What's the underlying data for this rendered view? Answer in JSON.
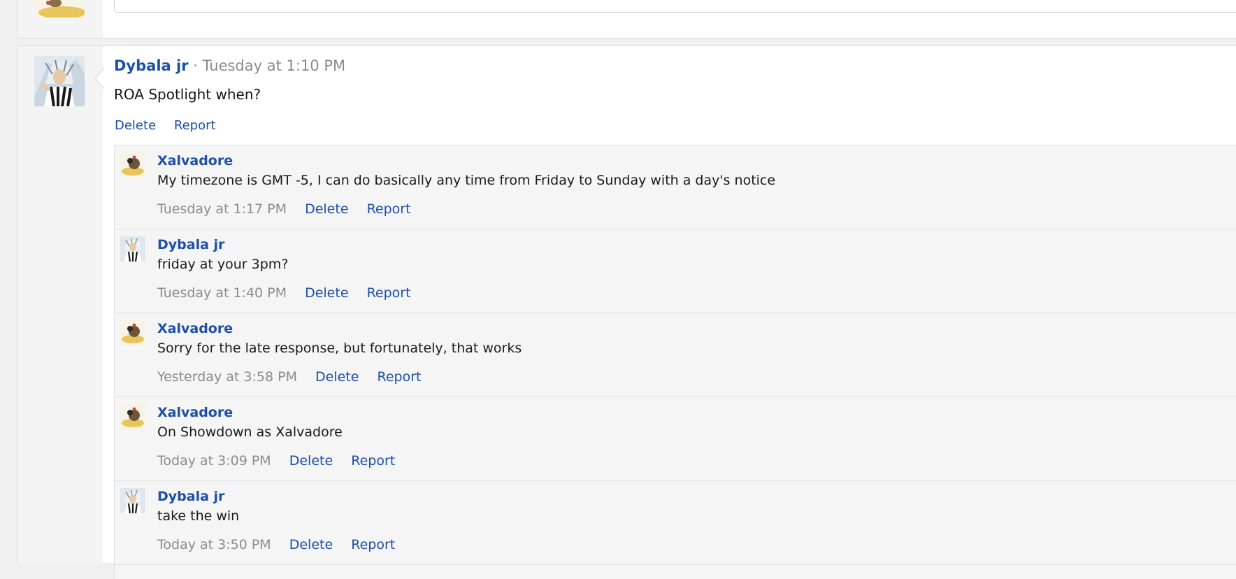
{
  "top_post": {
    "avatar": "xalvadore-avatar"
  },
  "post": {
    "author": "Dybala jr",
    "separator": "·",
    "time": "Tuesday at 1:10 PM",
    "text": "ROA Spotlight when?",
    "delete_label": "Delete",
    "report_label": "Report",
    "avatar": "dybala-avatar"
  },
  "comments": [
    {
      "author": "Xalvadore",
      "text": "My timezone is GMT -5, I can do basically any time from Friday to Sunday with a day's notice",
      "time": "Tuesday at 1:17 PM",
      "delete_label": "Delete",
      "report_label": "Report",
      "avatar": "xalvadore-avatar"
    },
    {
      "author": "Dybala jr",
      "text": "friday at your 3pm?",
      "time": "Tuesday at 1:40 PM",
      "delete_label": "Delete",
      "report_label": "Report",
      "avatar": "dybala-avatar"
    },
    {
      "author": "Xalvadore",
      "text": "Sorry for the late response, but fortunately, that works",
      "time": "Yesterday at 3:58 PM",
      "delete_label": "Delete",
      "report_label": "Report",
      "avatar": "xalvadore-avatar"
    },
    {
      "author": "Xalvadore",
      "text": "On Showdown as Xalvadore",
      "time": "Today at 3:09 PM",
      "delete_label": "Delete",
      "report_label": "Report",
      "avatar": "xalvadore-avatar"
    },
    {
      "author": "Dybala jr",
      "text": "take the win",
      "time": "Today at 3:50 PM",
      "delete_label": "Delete",
      "report_label": "Report",
      "avatar": "dybala-avatar"
    }
  ],
  "colors": {
    "link": "#1d4ea9",
    "muted": "#8a8a8a",
    "comment_bg": "#f5f5f5"
  }
}
